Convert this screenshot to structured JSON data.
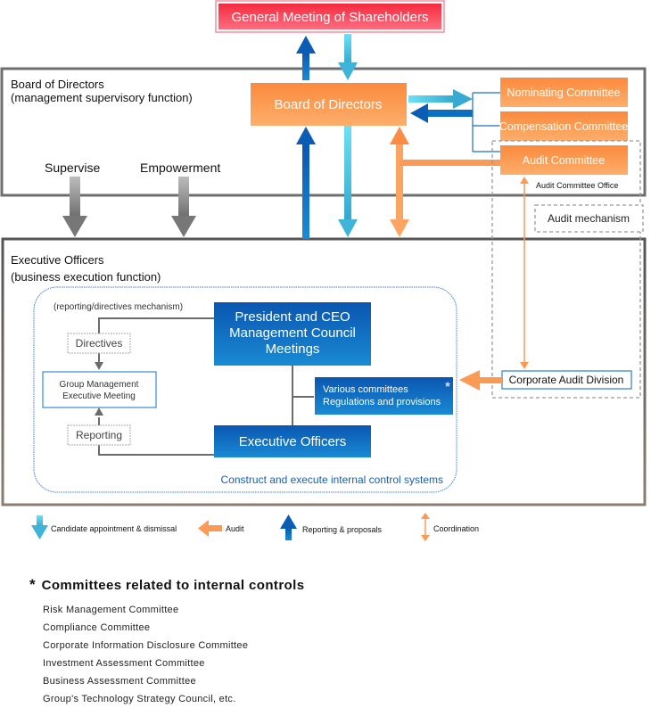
{
  "diagram": {
    "top_box": {
      "label": "General Meeting of Shareholders"
    },
    "board_section": {
      "title_line1": "Board of Directors",
      "title_line2": "(management supervisory function)",
      "supervise_label": "Supervise",
      "empowerment_label": "Empowerment",
      "board_box": "Board of Directors",
      "committees": [
        "Nominating Committee",
        "Compensation Committee",
        "Audit Committee"
      ],
      "audit_office_label": "Audit Committee Office"
    },
    "audit_mechanism_label": "Audit mechanism",
    "exec_section": {
      "title_line1": "Executive Officers",
      "title_line2": "(business execution function)",
      "mechanism_label": "(reporting/directives mechanism)",
      "directives_label": "Directives",
      "reporting_label": "Reporting",
      "group_meeting_line1": "Group Management",
      "group_meeting_line2": "Executive Meeting",
      "president_line1": "President and CEO",
      "president_line2": "Management Council",
      "president_line3": "Meetings",
      "various_line1": "Various committees",
      "various_line2": "Regulations and provisions",
      "various_marker": "*",
      "exec_officers_box": "Executive Officers",
      "internal_control_label": "Construct and execute internal control systems",
      "corporate_audit_label": "Corporate Audit Division"
    },
    "legend": [
      {
        "icon": "down-arrow-icon",
        "label": "Candidate appointment & dismissal",
        "color": "#4cc4e4"
      },
      {
        "icon": "left-arrow-icon",
        "label": "Audit",
        "color": "#f99a52"
      },
      {
        "icon": "up-arrow-icon",
        "label": "Reporting & proposals",
        "color": "#0b6fc0"
      },
      {
        "icon": "double-arrow-icon",
        "label": "Coordination",
        "color": "#f99a52"
      }
    ],
    "colors": {
      "shareholders_red": "#f23a4c",
      "orange": "#fb8a3c",
      "blue": "#0a66bf",
      "cyan": "#4cc4e4",
      "gray_frame": "#6e6e6e"
    }
  },
  "committees_list": {
    "marker": "*",
    "title": "Committees related to internal controls",
    "items": [
      "Risk Management Committee",
      "Compliance Committee",
      "Corporate Information Disclosure Committee",
      "Investment Assessment Committee",
      "Business Assessment Committee",
      "Group's Technology Strategy Council, etc."
    ]
  }
}
